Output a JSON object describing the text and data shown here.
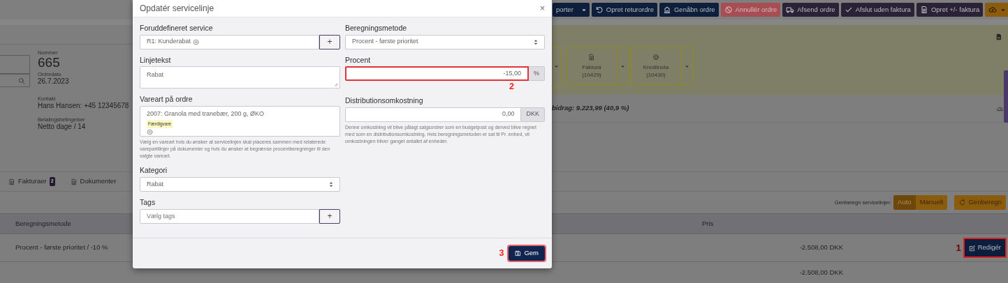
{
  "toolbar": [
    {
      "label": "porter",
      "kind": "split"
    },
    {
      "label": "Opret returordre",
      "kind": "plain"
    },
    {
      "label": "Genåbn ordre",
      "kind": "plain"
    },
    {
      "label": "Annullér ordre",
      "kind": "plain"
    },
    {
      "label": "Afsend ordre",
      "kind": "plain"
    },
    {
      "label": "Afslut uden faktura",
      "kind": "plain"
    },
    {
      "label": "Opret +/- faktura",
      "kind": "plain"
    },
    {
      "kind": "split"
    }
  ],
  "order": [
    {
      "label": "Nummer",
      "value": "665",
      "kind": "large"
    },
    {
      "label": "Ordredato",
      "value": "26.7.2023",
      "kind": "normal"
    },
    {
      "label": "Kontakt",
      "value": "Hans Hansen: +45 12345678",
      "kind": "normal"
    },
    {
      "label": "Betalingsbetingelser",
      "value": "Netto dage / 14",
      "kind": "normal"
    }
  ],
  "documents": [
    {
      "label": "Faktura",
      "number": "(10429)"
    },
    {
      "label": "Kreditnota",
      "number": "(10430)"
    }
  ],
  "summary": "bidrag: 9.223,99 (40,9 %)",
  "tabs": [
    {
      "label": "Fakturaer",
      "badge": "2"
    },
    {
      "label": "Dokumenter"
    }
  ],
  "recalc": {
    "label": "Genberegn servicelinjer:",
    "modes": [
      {
        "label": "Auto",
        "selected": true
      },
      {
        "label": "Manuelt",
        "selected": false
      }
    ],
    "button": "Genberegn"
  },
  "table": {
    "columns": [
      "Beregningsmetode",
      "Pris"
    ],
    "rows": [
      {
        "method": "Procent - første prioritet / -10 %",
        "price": "-2.508,00 DKK",
        "action": "Redigér",
        "annotation": "1"
      },
      {
        "price": "-2.508,00 DKK"
      }
    ]
  },
  "modal": {
    "title": "Opdatér servicelinje",
    "close": "×",
    "left": [
      {
        "label": "Foruddefineret service",
        "kind": "tagselect",
        "value": "R1: Kunderabat",
        "add": "+"
      },
      {
        "label": "Linjetekst",
        "kind": "textarea",
        "value": "Rabat"
      },
      {
        "label": "Vareart på ordre",
        "kind": "product",
        "value": "2007: Granola med tranebær, 200 g, ØKO",
        "tag": "Færdigvare",
        "help": "Vælg en vareart hvis du ønsker at servicelinjen skal placeres sammen med relaterede varepartilinjer på dokumenter og hvis du ønsker at begrænse procentberegninger til den valgte vareart."
      },
      {
        "label": "Kategori",
        "kind": "select",
        "value": "Rabat"
      },
      {
        "label": "Tags",
        "kind": "tagselect",
        "placeholder": "Vælg tags",
        "add": "+"
      }
    ],
    "right": [
      {
        "label": "Beregningsmetode",
        "kind": "select",
        "value": "Procent - første prioritet"
      },
      {
        "label": "Procent",
        "kind": "number",
        "value": "-15,00",
        "unit": "%",
        "annotation": "2"
      },
      {
        "label": "Distributionsomkostning",
        "kind": "number",
        "value": "0,00",
        "unit": "DKK",
        "help": "Denne omkostning vil blive pålagt salgsordrer som en budgetpost og derved blive regnet med som en distributionsomkostning. Hvis beregningsmetoden er sat til Pr. enhed, vil omkostningen bliver ganget antallet af enheder."
      }
    ],
    "save": {
      "label": "Gem",
      "annotation": "3"
    }
  }
}
